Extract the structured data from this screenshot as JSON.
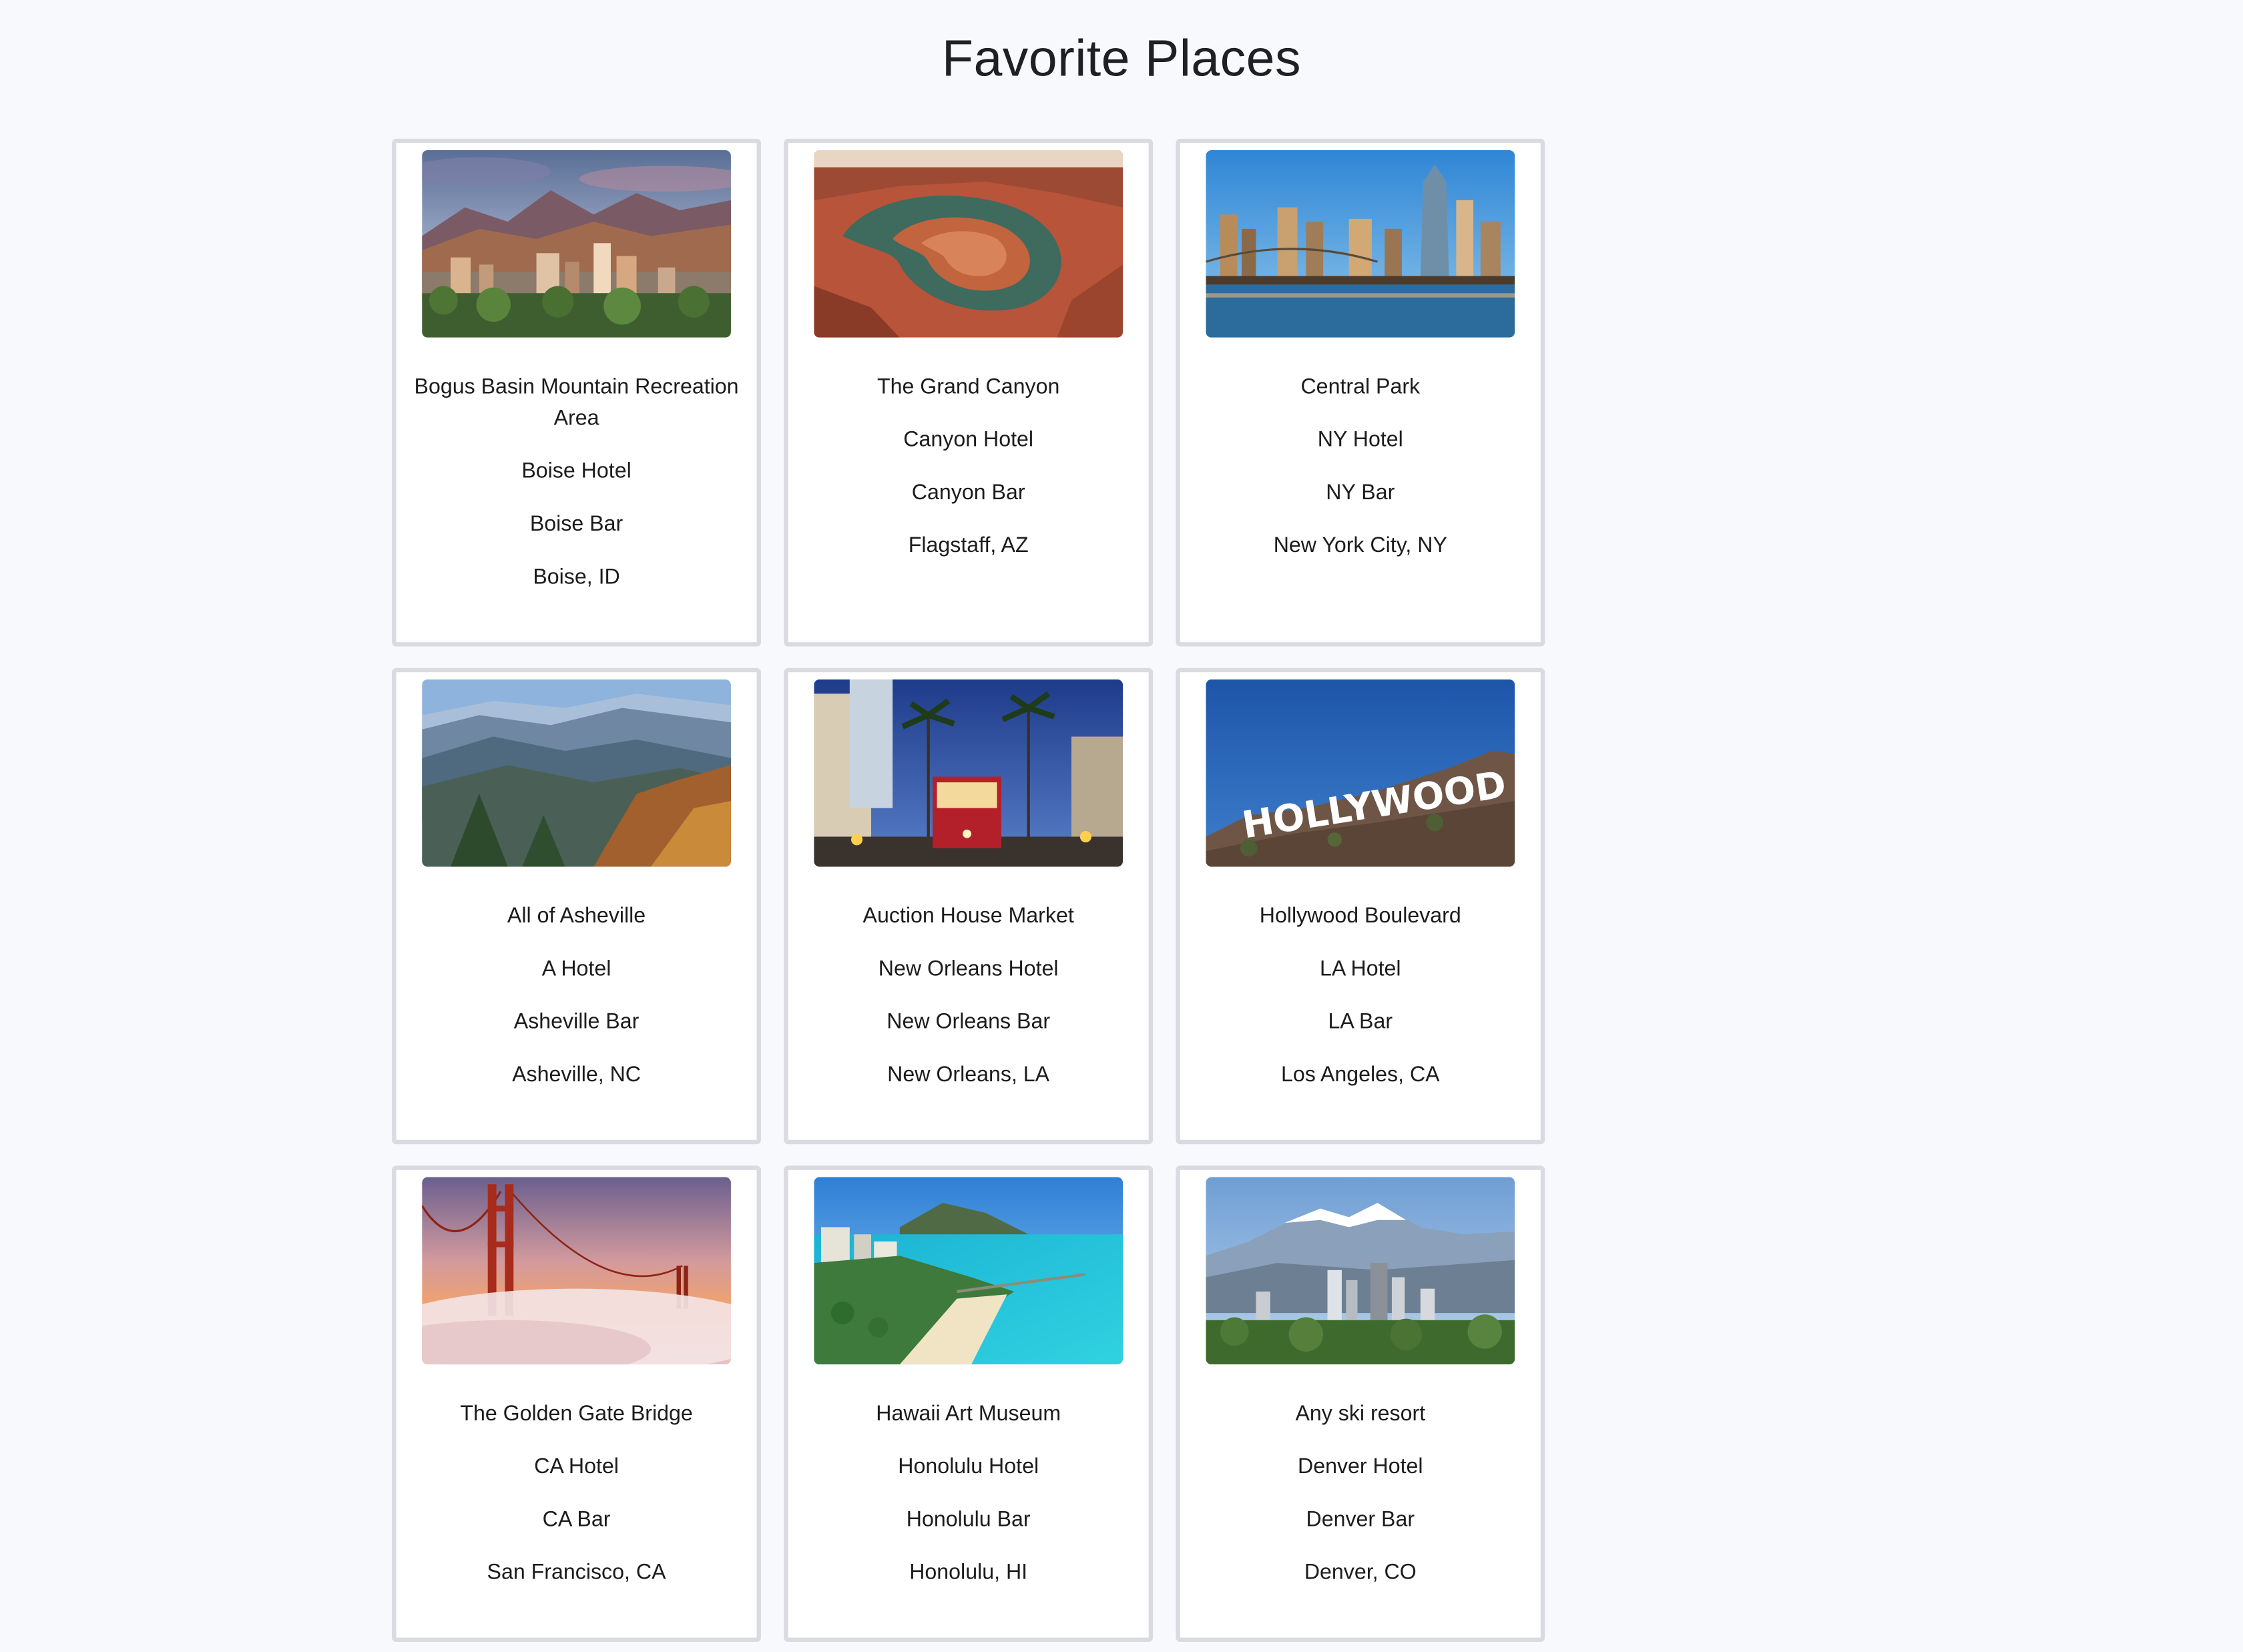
{
  "page": {
    "title": "Favorite Places"
  },
  "places": [
    {
      "attraction": "Bogus Basin Mountain Recreation Area",
      "hotel": "Boise Hotel",
      "bar": "Boise Bar",
      "location": "Boise, ID",
      "image_icon": "mountain-city-photo"
    },
    {
      "attraction": "The Grand Canyon",
      "hotel": "Canyon Hotel",
      "bar": "Canyon Bar",
      "location": "Flagstaff, AZ",
      "image_icon": "canyon-photo"
    },
    {
      "attraction": "Central Park",
      "hotel": "NY Hotel",
      "bar": "NY Bar",
      "location": "New York City, NY",
      "image_icon": "skyline-bridge-photo"
    },
    {
      "attraction": "All of Asheville",
      "hotel": "A Hotel",
      "bar": "Asheville Bar",
      "location": "Asheville, NC",
      "image_icon": "mountain-ridge-photo"
    },
    {
      "attraction": "Auction House Market",
      "hotel": "New Orleans Hotel",
      "bar": "New Orleans Bar",
      "location": "New Orleans, LA",
      "image_icon": "streetcar-photo"
    },
    {
      "attraction": "Hollywood Boulevard",
      "hotel": "LA Hotel",
      "bar": "LA Bar",
      "location": "Los Angeles, CA",
      "image_icon": "hollywood-sign-photo",
      "image_sign_text": "HOLLYWOOD"
    },
    {
      "attraction": "The Golden Gate Bridge",
      "hotel": "CA Hotel",
      "bar": "CA Bar",
      "location": "San Francisco, CA",
      "image_icon": "suspension-bridge-photo"
    },
    {
      "attraction": "Hawaii Art Museum",
      "hotel": "Honolulu Hotel",
      "bar": "Honolulu Bar",
      "location": "Honolulu, HI",
      "image_icon": "beach-photo"
    },
    {
      "attraction": "Any ski resort",
      "hotel": "Denver Hotel",
      "bar": "Denver Bar",
      "location": "Denver, CO",
      "image_icon": "snow-mountain-city-photo"
    }
  ]
}
